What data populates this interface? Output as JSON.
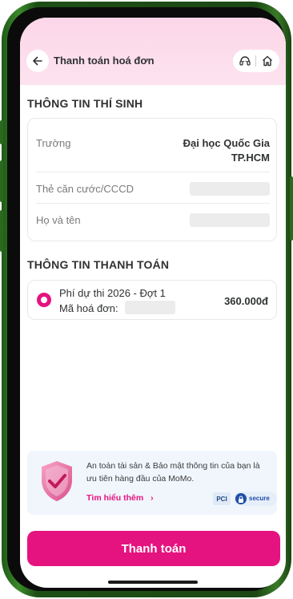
{
  "header": {
    "title": "Thanh toán hoá đơn",
    "back_icon": "arrow-left-icon",
    "support_icon": "headset-icon",
    "home_icon": "home-icon"
  },
  "candidate": {
    "section_title": "THÔNG TIN THÍ SINH",
    "school_label": "Trường",
    "school_value_line1": "Đại học Quốc Gia",
    "school_value_line2": "TP.HCM",
    "id_label": "Thẻ căn cước/CCCD",
    "name_label": "Họ và tên"
  },
  "payment": {
    "section_title": "THÔNG TIN THANH TOÁN",
    "item_name": "Phí dự thi 2026 - Đợt 1",
    "invoice_label": "Mã hoá đơn:",
    "amount": "360.000đ"
  },
  "banner": {
    "text": "An toàn tài sản & Bảo mật thông tin của bạn là ưu tiên hàng đầu của MoMo.",
    "link": "Tìm hiểu thêm",
    "link_arrow": "›",
    "pci_badge": "PCI",
    "secure_badge": "secure"
  },
  "footer": {
    "pay_button": "Thanh toán"
  },
  "colors": {
    "accent": "#e5137f",
    "header_bg": "#fcd6e8",
    "banner_bg": "#f1f6fd",
    "frame": "#2a6a1e"
  }
}
